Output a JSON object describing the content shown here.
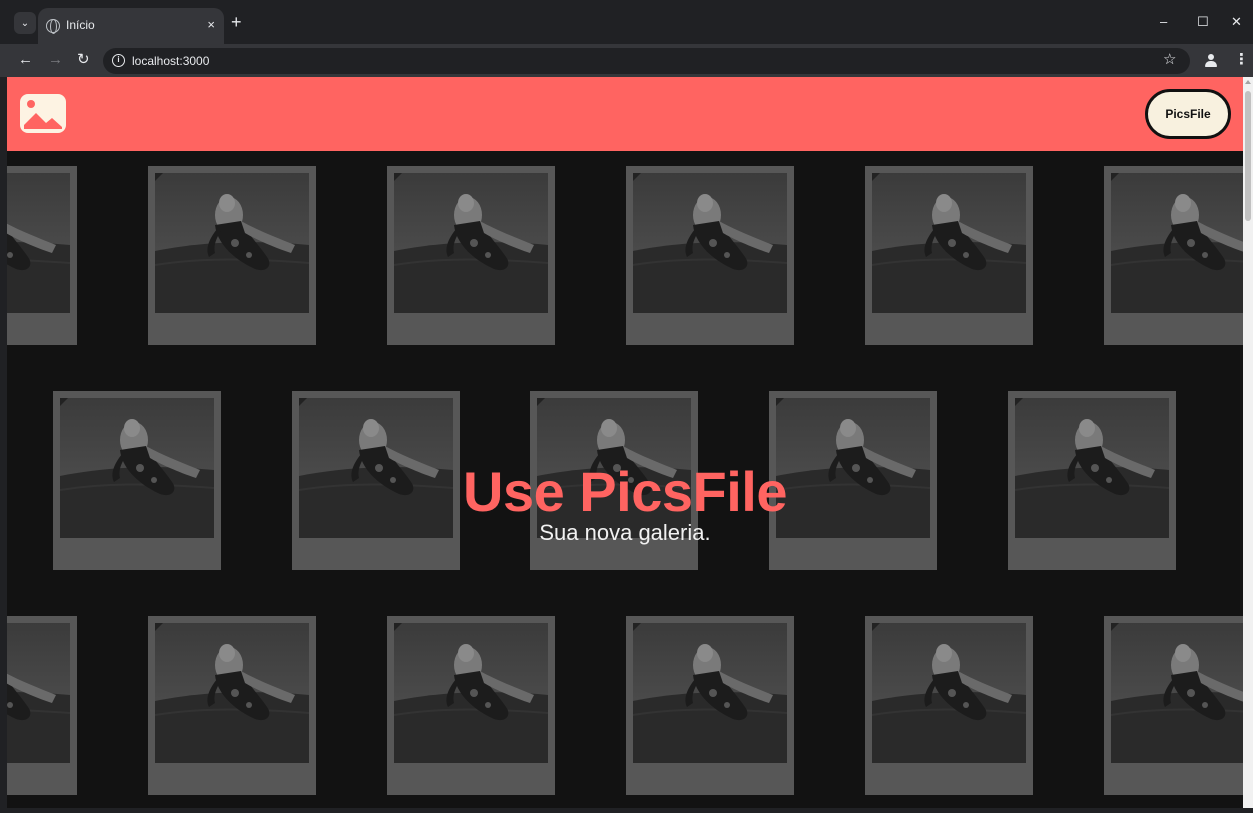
{
  "browser": {
    "tab_title": "Início",
    "tab_close": "×",
    "new_tab": "+",
    "window_controls": {
      "minimize": "–",
      "maximize": "☐",
      "close": "✕"
    },
    "nav": {
      "back": "←",
      "forward": "→",
      "reload": "↻"
    },
    "url": "localhost:3000",
    "site_info": "i",
    "bookmark": "☆",
    "menu": "⋮",
    "tab_search_icon": "⌄"
  },
  "header": {
    "background": "#ff6461",
    "logo_icon": "image-icon",
    "cta_label": "PicsFile"
  },
  "hero": {
    "title": "Use PicsFile",
    "subtitle": "Sua nova galeria."
  },
  "gallery": {
    "photo_description": "paraquedista",
    "frame_color": "#575757"
  }
}
